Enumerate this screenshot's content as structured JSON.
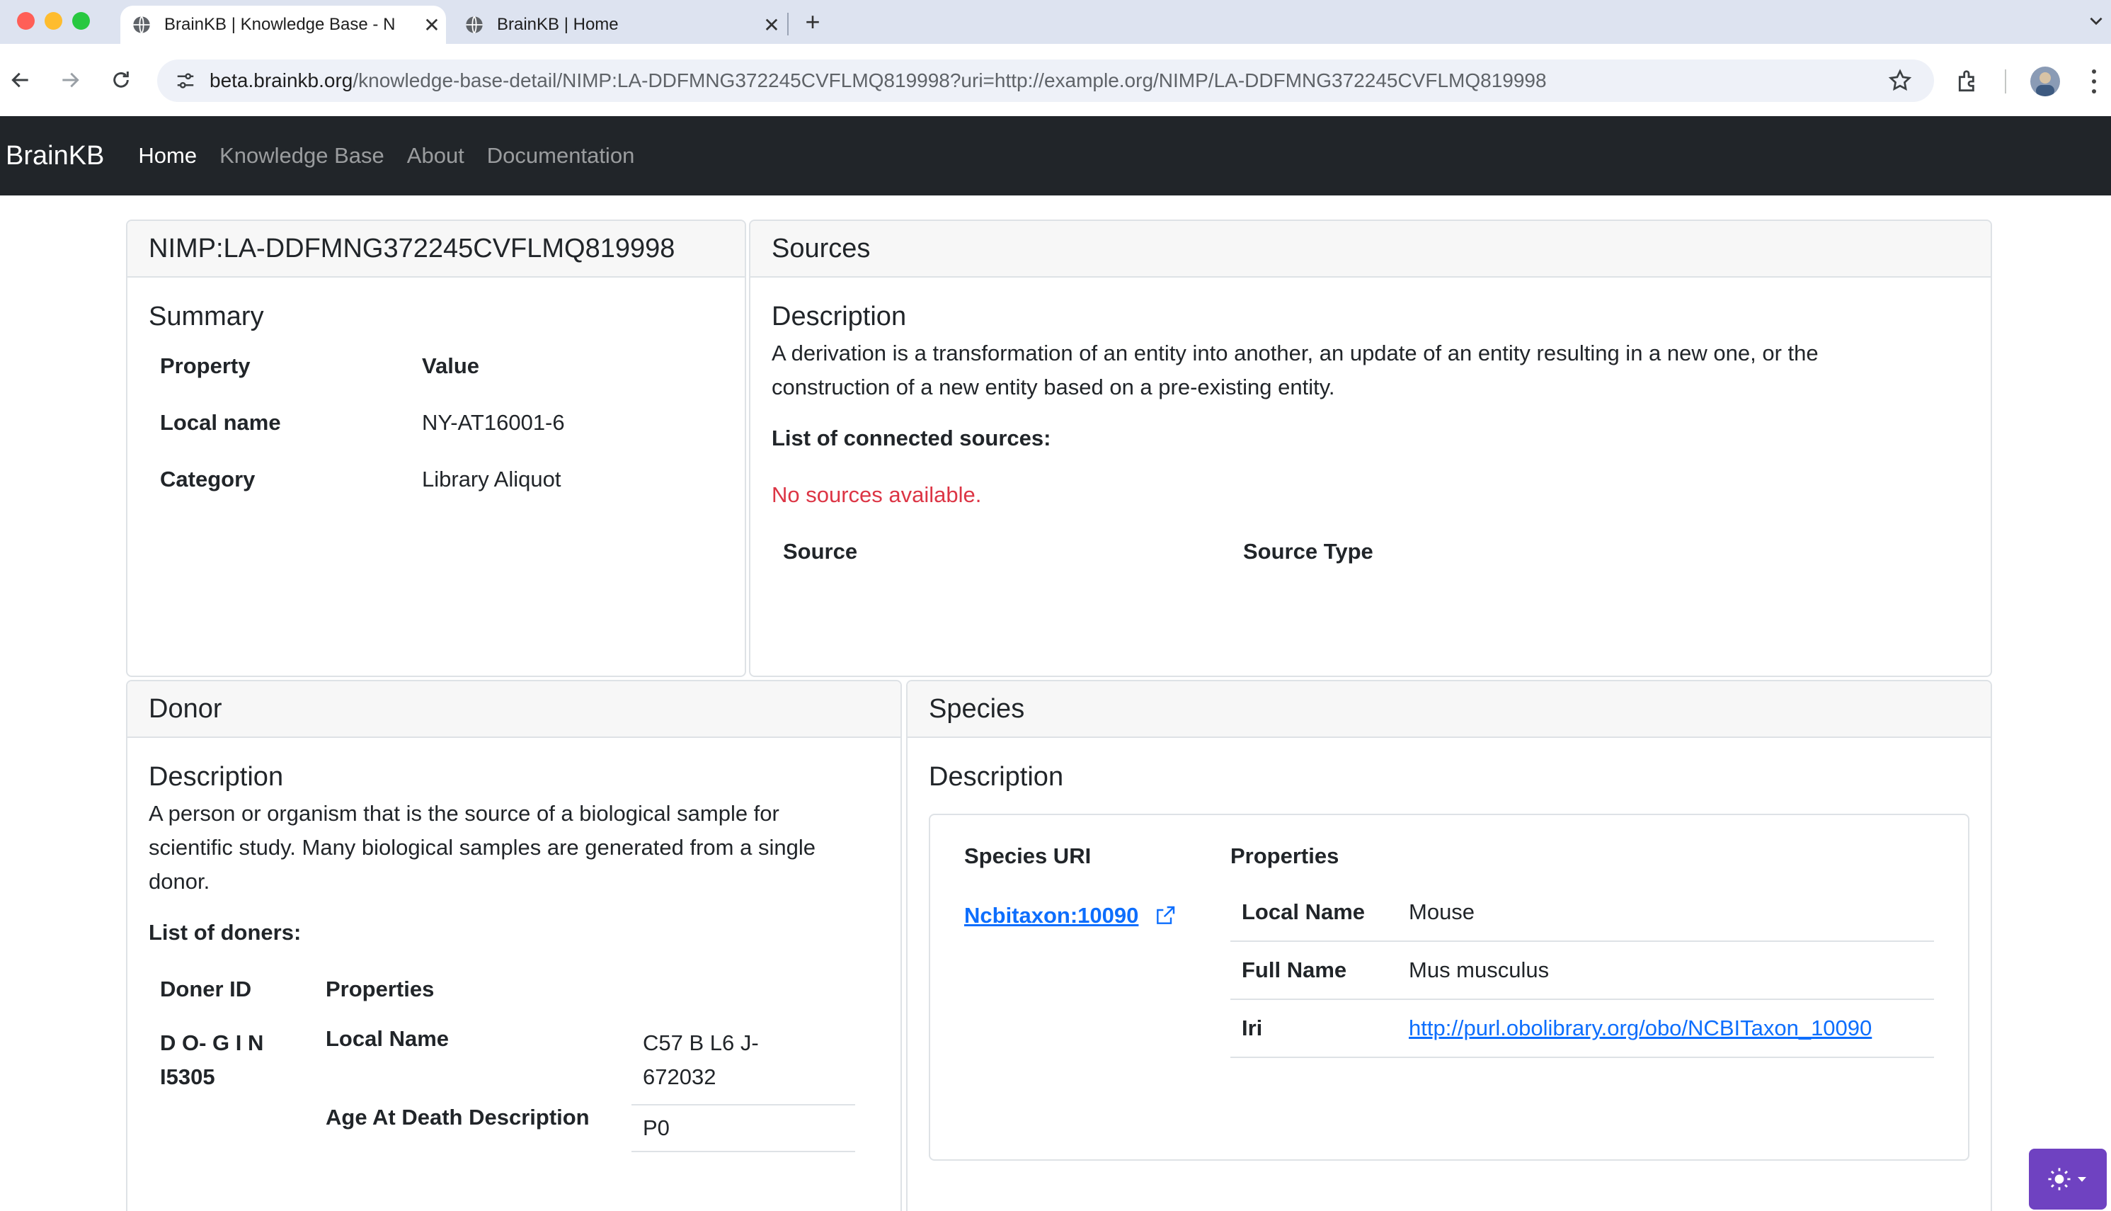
{
  "browser": {
    "tabs": [
      {
        "title": "BrainKB | Knowledge Base - N",
        "active": true
      },
      {
        "title": "BrainKB | Home",
        "active": false
      }
    ],
    "url_host": "beta.brainkb.org",
    "url_path": "/knowledge-base-detail/NIMP:LA-DDFMNG372245CVFLMQ819998?uri=http://example.org/NIMP/LA-DDFMNG372245CVFLMQ819998",
    "new_tab_glyph": "+",
    "close_glyph": "✕"
  },
  "navbar": {
    "brand": "BrainKB",
    "links": [
      "Home",
      "Knowledge Base",
      "About",
      "Documentation"
    ],
    "active_index": 0
  },
  "entity_card": {
    "header": "NIMP:LA-DDFMNG372245CVFLMQ819998",
    "summary_title": "Summary",
    "col_property": "Property",
    "col_value": "Value",
    "rows": [
      {
        "key": "Local name",
        "value": "NY-AT16001-6"
      },
      {
        "key": "Category",
        "value": "Library Aliquot"
      }
    ]
  },
  "sources_card": {
    "header": "Sources",
    "desc_title": "Description",
    "description": "A derivation is a transformation of an entity into another, an update of an entity resulting in a new one, or the construction of a new entity based on a pre-existing entity.",
    "list_label": "List of connected sources:",
    "empty_message": "No sources available.",
    "col_source": "Source",
    "col_source_type": "Source Type"
  },
  "donor_card": {
    "header": "Donor",
    "desc_title": "Description",
    "description": "A person or organism that is the source of a biological sample for scientific study. Many biological samples are generated from a single donor.",
    "list_label": "List of doners:",
    "col_id": "Doner ID",
    "col_props": "Properties",
    "donor_id_line1": "D O- G I N",
    "donor_id_line2": "I5305",
    "props": [
      {
        "key": "Local Name",
        "value_line1": "C57 B L6 J-",
        "value_line2": "672032"
      },
      {
        "key": "Age At Death Description",
        "value_line1": "P0",
        "value_line2": ""
      }
    ]
  },
  "species_card": {
    "header": "Species",
    "desc_title": "Description",
    "col_uri": "Species URI",
    "col_props": "Properties",
    "uri_link": "Ncbitaxon:10090",
    "props": [
      {
        "key": "Local Name",
        "value": "Mouse"
      },
      {
        "key": "Full Name",
        "value": "Mus musculus"
      },
      {
        "key": "Iri",
        "value": "http://purl.obolibrary.org/obo/NCBITaxon_10090"
      }
    ]
  },
  "colors": {
    "navbar_bg": "#212529",
    "link": "#0d6efd",
    "error_text": "#dc3545",
    "theme_button": "#6f42c1"
  }
}
